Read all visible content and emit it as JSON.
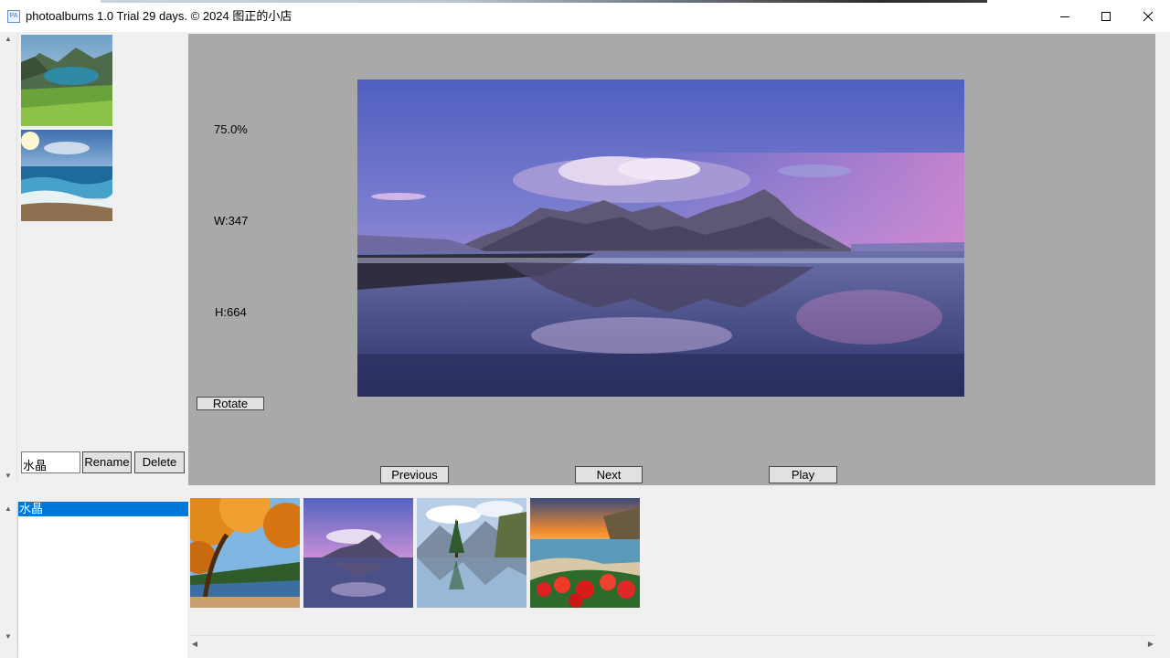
{
  "window": {
    "title": "photoalbums 1.0 Trial 29 days. © 2024 图正的小店",
    "icon_label": "PA",
    "minimize_icon": "minimize-icon",
    "maximize_icon": "maximize-icon",
    "close_icon": "close-icon"
  },
  "left_panel": {
    "thumbnails": [
      "mountain-lake-thumbnail",
      "ocean-sunset-thumbnail"
    ],
    "name_input_value": "水晶",
    "rename_label": "Rename",
    "delete_label": "Delete"
  },
  "viewer": {
    "zoom": "75.0%",
    "width": "W:347",
    "height": "H:664",
    "rotate_label": "Rotate",
    "previous_label": "Previous",
    "next_label": "Next",
    "play_label": "Play"
  },
  "albums": {
    "items": [
      "水晶"
    ],
    "selected_index": 0
  },
  "strip": {
    "thumbnails": [
      "autumn-tree-lake",
      "mountain-beach-reflection",
      "alpine-lake-trees",
      "coastal-flowers-sunset"
    ]
  },
  "colors": {
    "selection": "#0078d7",
    "viewer_bg": "#a9a9a9"
  }
}
